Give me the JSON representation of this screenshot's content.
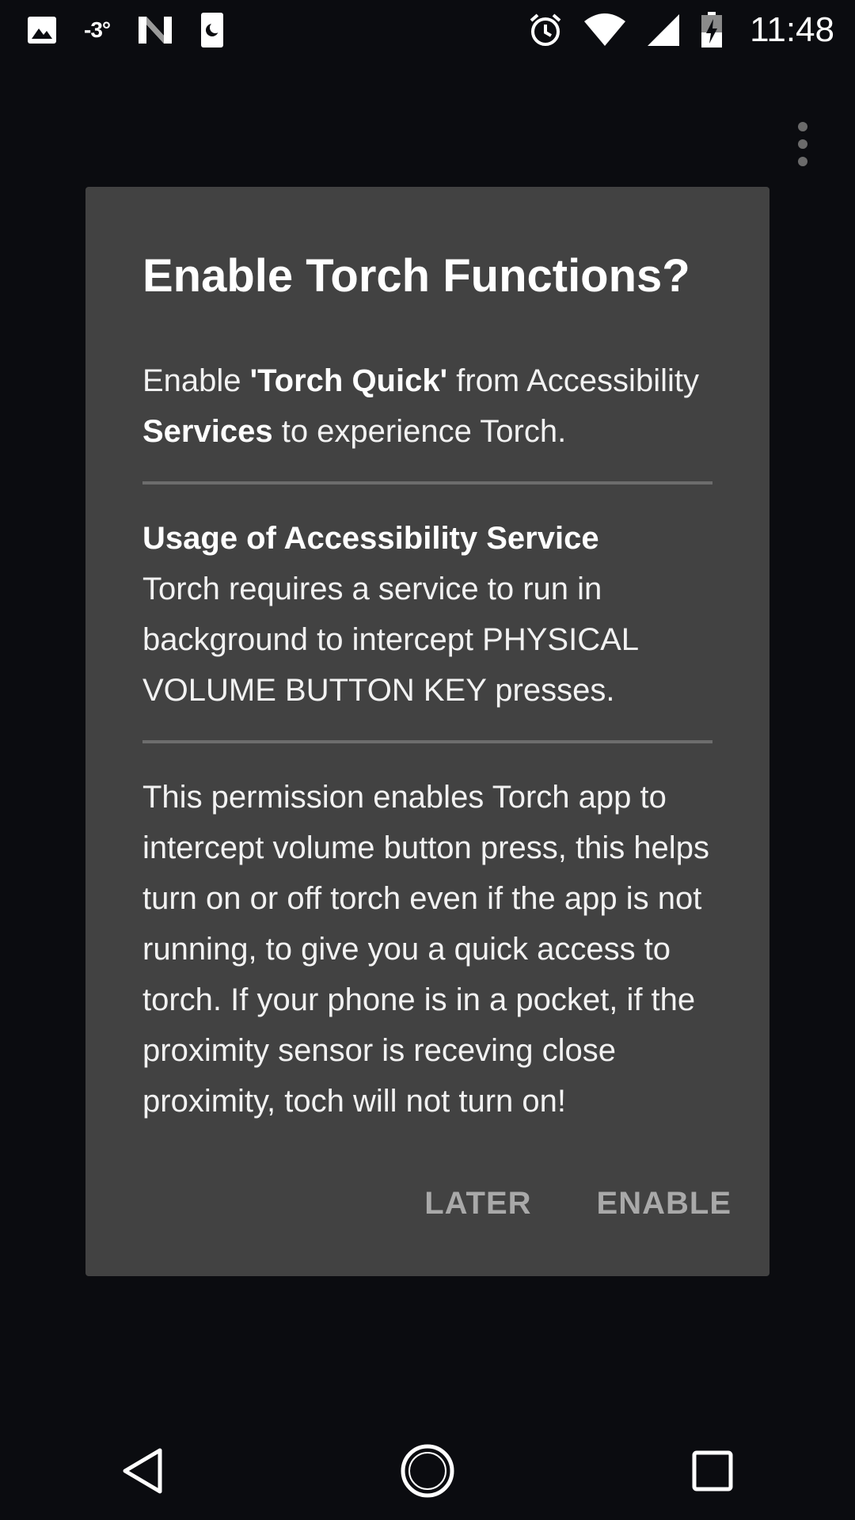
{
  "status_bar": {
    "left_icons": [
      "image-icon",
      "weather-icon",
      "n-logo-icon",
      "moon-sim-icon"
    ],
    "temperature": "-3°",
    "right_icons": [
      "alarm-icon",
      "wifi-icon",
      "signal-icon",
      "battery-charging-icon"
    ],
    "time": "11:48"
  },
  "dialog": {
    "title": "Enable Torch Functions?",
    "intro": {
      "t1": "Enable ",
      "b1": "'Torch Quick'",
      "t2": " from Accessibility ",
      "b2": "Services",
      "t3": " to experience Torch."
    },
    "usage_heading": "Usage of Accessibility Service",
    "usage_text": "Torch requires a service to run in background to intercept PHYSICAL VOLUME BUTTON KEY presses.",
    "permission_text": "This permission enables Torch app to intercept volume button press, this helps turn on or off torch even if the app is not running, to give you a quick access to torch. If your phone is in a pocket, if the proximity sensor is receving close proximity, toch will not turn on!",
    "actions": {
      "later": "LATER",
      "enable": "ENABLE"
    }
  },
  "nav_bar": {
    "icons": [
      "back-icon",
      "home-icon",
      "recents-icon"
    ]
  },
  "colors": {
    "background": "#0b0c10",
    "dialog": "#424242",
    "divider": "#6d6d6d",
    "action_text": "#a9a9a9"
  }
}
